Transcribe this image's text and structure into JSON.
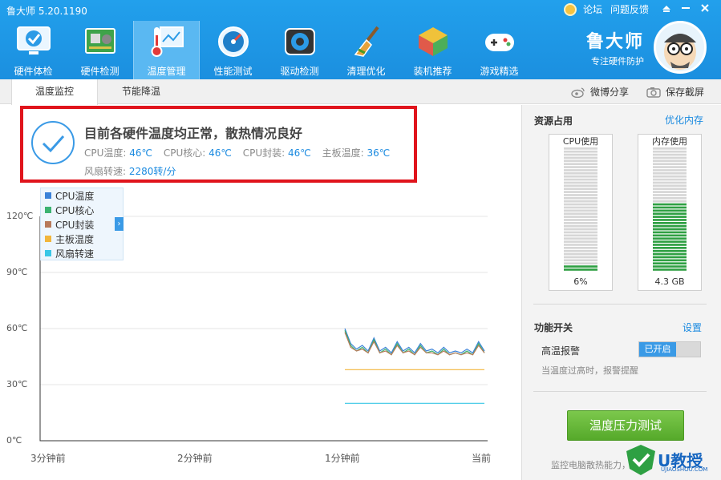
{
  "app": {
    "title": "鲁大师 5.20.1190"
  },
  "top_links": [
    "论坛",
    "问题反馈"
  ],
  "window_controls": [
    "settings-icon",
    "minimize-icon",
    "close-icon"
  ],
  "nav": [
    {
      "label": "硬件体检",
      "icon": "monitor-check-icon"
    },
    {
      "label": "硬件检测",
      "icon": "circuit-board-icon"
    },
    {
      "label": "温度管理",
      "icon": "thermometer-icon",
      "active": true
    },
    {
      "label": "性能测试",
      "icon": "speedometer-icon"
    },
    {
      "label": "驱动检测",
      "icon": "gear-chip-icon"
    },
    {
      "label": "清理优化",
      "icon": "broom-icon"
    },
    {
      "label": "装机推荐",
      "icon": "cube-icon"
    },
    {
      "label": "游戏精选",
      "icon": "gamepad-icon"
    }
  ],
  "brand": {
    "name": "鲁大师",
    "slogan": "专注硬件防护"
  },
  "subtabs": [
    "温度监控",
    "节能降温"
  ],
  "actions": {
    "share": "微博分享",
    "screenshot": "保存截屏"
  },
  "status": {
    "headline": "目前各硬件温度均正常，散热情况良好",
    "cpu_temp_label": "CPU温度:",
    "cpu_temp": "46℃",
    "cpu_core_label": "CPU核心:",
    "cpu_core": "46℃",
    "cpu_pkg_label": "CPU封装:",
    "cpu_pkg": "46℃",
    "board_label": "主板温度:",
    "board": "36℃",
    "fan_label": "风扇转速:",
    "fan": "2280转/分"
  },
  "chart_data": {
    "type": "line",
    "y_ticks": [
      "120℃",
      "90℃",
      "60℃",
      "30℃",
      "0℃"
    ],
    "ylim": [
      0,
      120
    ],
    "x_ticks": [
      "3分钟前",
      "2分钟前",
      "1分钟前",
      "当前"
    ],
    "legend": [
      {
        "name": "CPU温度",
        "color": "#3b82d8"
      },
      {
        "name": "CPU核心",
        "color": "#3cb371"
      },
      {
        "name": "CPU封装",
        "color": "#b87a5a"
      },
      {
        "name": "主板温度",
        "color": "#f2b63c"
      },
      {
        "name": "风扇转速",
        "color": "#39c7e6"
      }
    ],
    "series": [
      {
        "name": "CPU温度",
        "values": [
          60,
          52,
          49,
          51,
          48,
          55,
          48,
          50,
          47,
          53,
          48,
          50,
          47,
          52,
          48,
          49,
          47,
          50,
          47,
          48,
          47,
          49,
          47,
          53,
          48
        ]
      },
      {
        "name": "CPU核心",
        "values": [
          59,
          51,
          48,
          50,
          47,
          54,
          47,
          49,
          46,
          52,
          47,
          49,
          46,
          51,
          47,
          48,
          46,
          49,
          46,
          47,
          46,
          48,
          46,
          52,
          47
        ]
      },
      {
        "name": "CPU封装",
        "values": [
          58,
          50,
          48,
          49,
          47,
          53,
          47,
          48,
          46,
          51,
          47,
          48,
          46,
          50,
          47,
          47,
          46,
          48,
          46,
          47,
          46,
          47,
          46,
          51,
          47
        ]
      },
      {
        "name": "主板温度",
        "values": [
          38,
          38,
          38,
          38,
          38,
          38,
          38,
          38,
          38,
          38,
          38,
          38,
          38,
          38,
          38,
          38,
          38,
          38,
          38,
          38,
          38,
          38,
          38,
          38,
          38
        ]
      },
      {
        "name": "风扇转速",
        "values": [
          20,
          20,
          20,
          20,
          20,
          20,
          20,
          20,
          20,
          20,
          20,
          20,
          20,
          20,
          20,
          20,
          20,
          20,
          20,
          20,
          20,
          20,
          20,
          20,
          20
        ]
      }
    ]
  },
  "resources": {
    "title": "资源占用",
    "optimize": "优化内存",
    "cpu_label": "CPU使用",
    "cpu_value": "6%",
    "cpu_level": 0.06,
    "mem_label": "内存使用",
    "mem_value": "4.3 GB",
    "mem_level": 0.55
  },
  "features": {
    "title": "功能开关",
    "settings": "设置",
    "alarm_label": "高温报警",
    "alarm_state": "已开启",
    "alarm_hint": "当温度过高时，报警提醒"
  },
  "stress_test": {
    "label": "温度压力测试",
    "note": "监控电脑散热能力，保障"
  },
  "watermark": {
    "text": "U教授",
    "sub": "UJIAOSHOU.COM"
  }
}
